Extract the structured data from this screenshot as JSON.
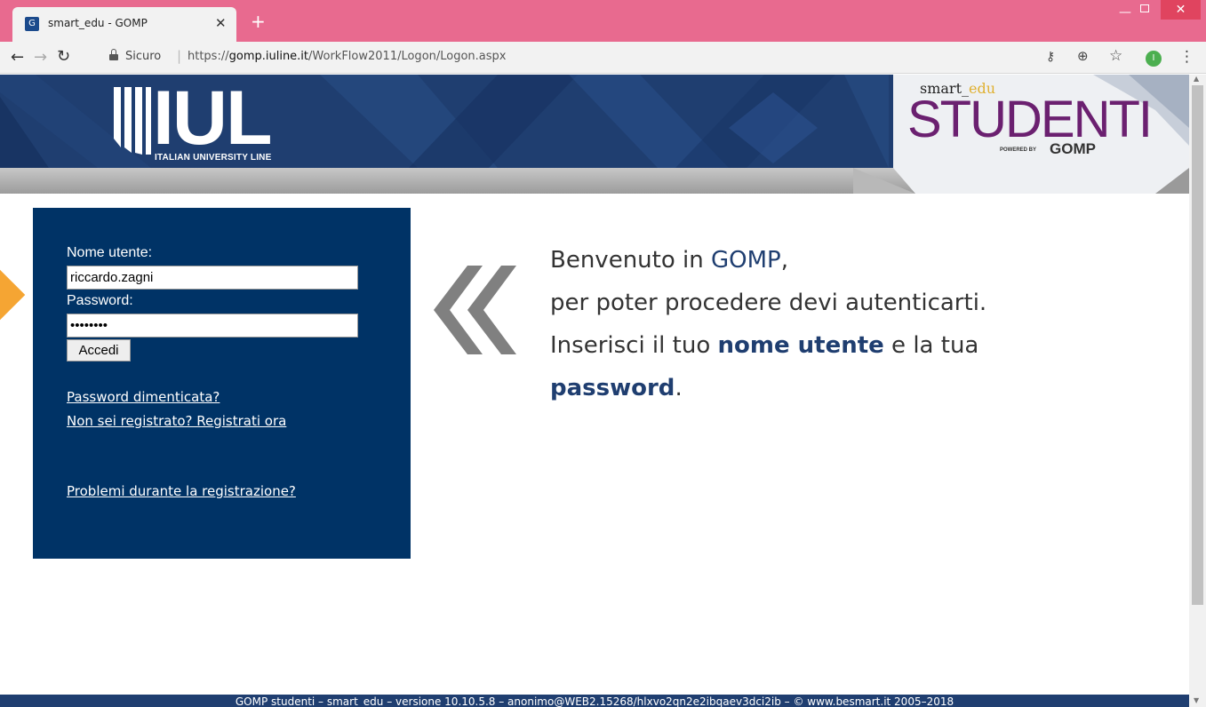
{
  "browser": {
    "tab_title": "smart_edu - GOMP",
    "tab_favicon": "G",
    "new_tab_symbol": "+",
    "secure_label": "Sicuro",
    "url_prefix": "https://",
    "url_domain": "gomp.iuline.it",
    "url_path": "/WorkFlow2011/Logon/Logon.aspx",
    "profile_initial": "I"
  },
  "banner": {
    "logo_word": "IUL",
    "logo_subtitle": "ITALIAN UNIVERSITY LINE",
    "brand_small_a": "smart_",
    "brand_small_b": "edu",
    "brand_big": "STUDENTI",
    "brand_powered": "POWERED BY",
    "brand_gomp": "GOMP"
  },
  "login": {
    "username_label": "Nome utente:",
    "username_value": "riccardo.zagni",
    "password_label": "Password:",
    "password_value": "••••••••",
    "submit_label": "Accedi",
    "forgot_link": "Password dimenticata?",
    "register_link": "Non sei registrato? Registrati ora",
    "problems_link": "Problemi durante la registrazione?"
  },
  "welcome": {
    "line1_a": "Benvenuto in ",
    "line1_b": "GOMP",
    "line1_c": ",",
    "line2": "per poter procedere devi autenticarti.",
    "line3_a": "Inserisci il tuo ",
    "line3_b": "nome utente",
    "line3_c": " e la tua",
    "line4_a": "password",
    "line4_b": "."
  },
  "footer": {
    "text": "GOMP studenti – smart_edu – versione 10.10.5.8 – anonimo@WEB2.15268/hlxvo2qn2e2ibqaev3dci2ib – © www.besmart.it 2005–2018"
  },
  "colors": {
    "tab_strip": "#e86a8f",
    "navy": "#1f3e70",
    "panel": "#003366",
    "brand_purple": "#6b2070",
    "accent_orange": "#f5a533"
  }
}
